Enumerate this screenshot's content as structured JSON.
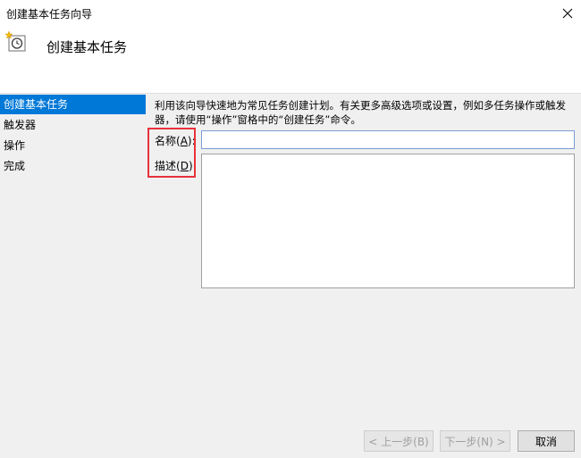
{
  "window": {
    "title": "创建基本任务向导",
    "close_icon": "close-icon"
  },
  "header": {
    "icon": "scheduled-task-icon",
    "heading": "创建基本任务"
  },
  "sidebar": {
    "items": [
      {
        "label": "创建基本任务",
        "selected": true
      },
      {
        "label": "触发器",
        "selected": false
      },
      {
        "label": "操作",
        "selected": false
      },
      {
        "label": "完成",
        "selected": false
      }
    ]
  },
  "main": {
    "description": "利用该向导快速地为常见任务创建计划。有关更多高级选项或设置，例如多任务操作或触发器，请使用“操作”窗格中的“创建任务”命令。",
    "name_label": "名称",
    "name_key": "A",
    "name_value": "",
    "desc_label": "描述",
    "desc_key": "D",
    "desc_value": ""
  },
  "footer": {
    "back_label": "< 上一步(B)",
    "next_label": "下一步(N) >",
    "cancel_label": "取消"
  },
  "colors": {
    "selected_bg": "#0078d7",
    "highlight_border": "#e8323c",
    "input_focus_border": "#7a9cd3"
  }
}
